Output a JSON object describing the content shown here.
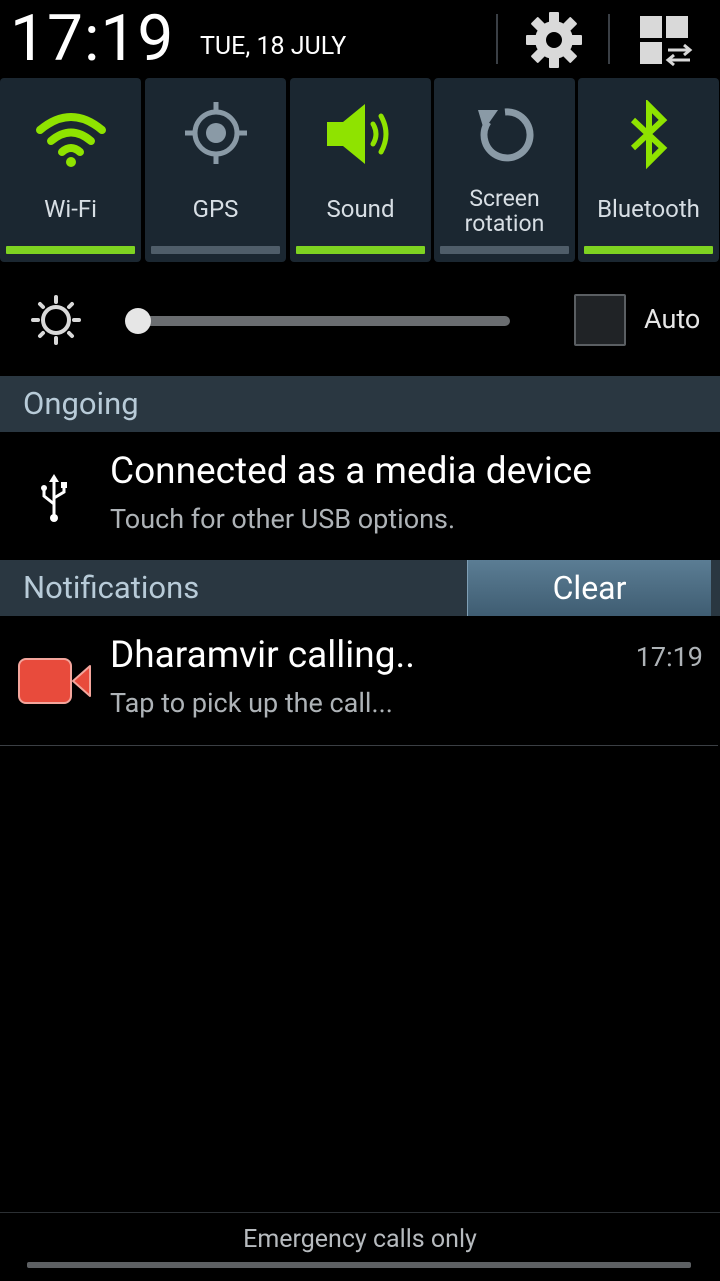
{
  "header": {
    "time": "17:19",
    "date": "TUE, 18 JULY",
    "settings_icon": "gear-icon",
    "edit_icon": "grid-swap-icon"
  },
  "quick_settings": [
    {
      "label": "Wi-Fi",
      "icon": "wifi-icon",
      "enabled": true
    },
    {
      "label": "GPS",
      "icon": "gps-icon",
      "enabled": false
    },
    {
      "label": "Sound",
      "icon": "speaker-icon",
      "enabled": true
    },
    {
      "label": "Screen rotation",
      "line1": "Screen",
      "line2": "rotation",
      "icon": "rotation-icon",
      "enabled": false
    },
    {
      "label": "Bluetooth",
      "icon": "bluetooth-icon",
      "enabled": true
    }
  ],
  "brightness": {
    "icon": "brightness-icon",
    "level": 0.0,
    "auto_label": "Auto",
    "auto_checked": false
  },
  "ongoing": {
    "title": "Ongoing",
    "items": [
      {
        "icon": "usb-icon",
        "title": "Connected as a media device",
        "subtitle": "Touch for other USB options."
      }
    ]
  },
  "notifications": {
    "title": "Notifications",
    "clear_label": "Clear",
    "items": [
      {
        "icon": "video-camera-icon",
        "title": "Dharamvir calling..",
        "subtitle": "Tap to pick up the call...",
        "time": "17:19"
      }
    ]
  },
  "footer": {
    "text": "Emergency calls only"
  },
  "colors": {
    "accent_on": "#7ed321",
    "accent_off": "#4f5d69",
    "tile_bg": "#1b2731",
    "section_bg": "#2a3741",
    "call_icon": "#e84b3c"
  }
}
